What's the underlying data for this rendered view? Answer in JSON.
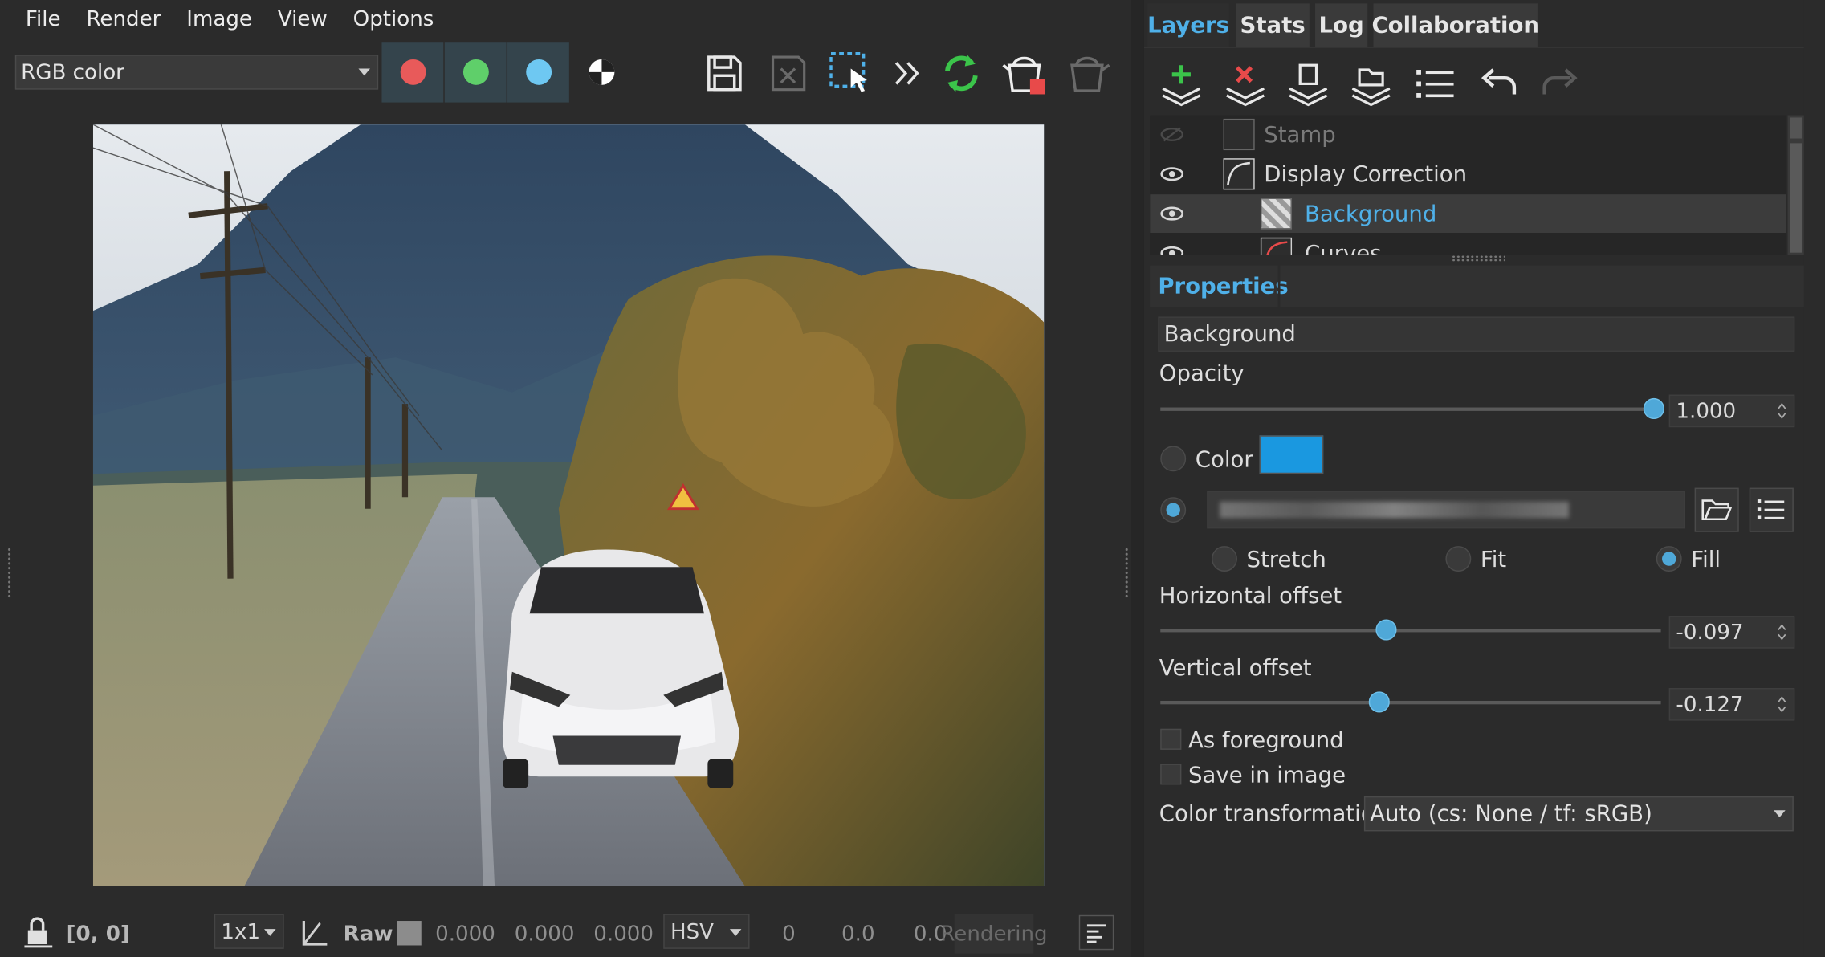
{
  "menu": {
    "items": [
      "File",
      "Render",
      "Image",
      "View",
      "Options"
    ]
  },
  "toolbar": {
    "color_mode": "RGB color",
    "channels": [
      {
        "name": "red-channel-button",
        "color": "#e85a5a"
      },
      {
        "name": "green-channel-button",
        "color": "#5fcf6a"
      },
      {
        "name": "blue-channel-button",
        "color": "#6ec8f2"
      }
    ],
    "accent_green": "#3bc44a",
    "accent_red": "#e84a4a"
  },
  "status": {
    "coords": "[0, 0]",
    "zoom": "1x1",
    "raw_label": "Raw",
    "rgb_values": [
      "0.000",
      "0.000",
      "0.000"
    ],
    "color_space": "HSV",
    "hsv_values": [
      "0",
      "0.0",
      "0.0"
    ],
    "rendering": "Rendering"
  },
  "tabs": [
    "Layers",
    "Stats",
    "Log",
    "Collaboration"
  ],
  "layers": [
    {
      "name": "Stamp",
      "visible": false,
      "indent": 0,
      "icon": "info-icon",
      "dim": true
    },
    {
      "name": "Display Correction",
      "visible": true,
      "indent": 0,
      "icon": "curve-icon"
    },
    {
      "name": "Background",
      "visible": true,
      "indent": 1,
      "icon": "checker-icon",
      "selected": true
    },
    {
      "name": "Curves",
      "visible": true,
      "indent": 1,
      "icon": "curve-icon"
    }
  ],
  "properties": {
    "title": "Properties",
    "layer_name": "Background",
    "opacity_label": "Opacity",
    "opacity_value": "1.000",
    "opacity_fraction": 1.0,
    "color_label": "Color",
    "color_swatch": "#1a98e0",
    "fit_modes": [
      "Stretch",
      "Fit",
      "Fill"
    ],
    "fit_selected": "Fill",
    "h_offset_label": "Horizontal offset",
    "h_offset_value": "-0.097",
    "h_offset_fraction": 0.45,
    "v_offset_label": "Vertical offset",
    "v_offset_value": "-0.127",
    "v_offset_fraction": 0.437,
    "as_foreground_label": "As foreground",
    "save_in_image_label": "Save in image",
    "color_transform_label": "Color transformation",
    "color_transform_value": "Auto (cs: None / tf: sRGB)"
  }
}
